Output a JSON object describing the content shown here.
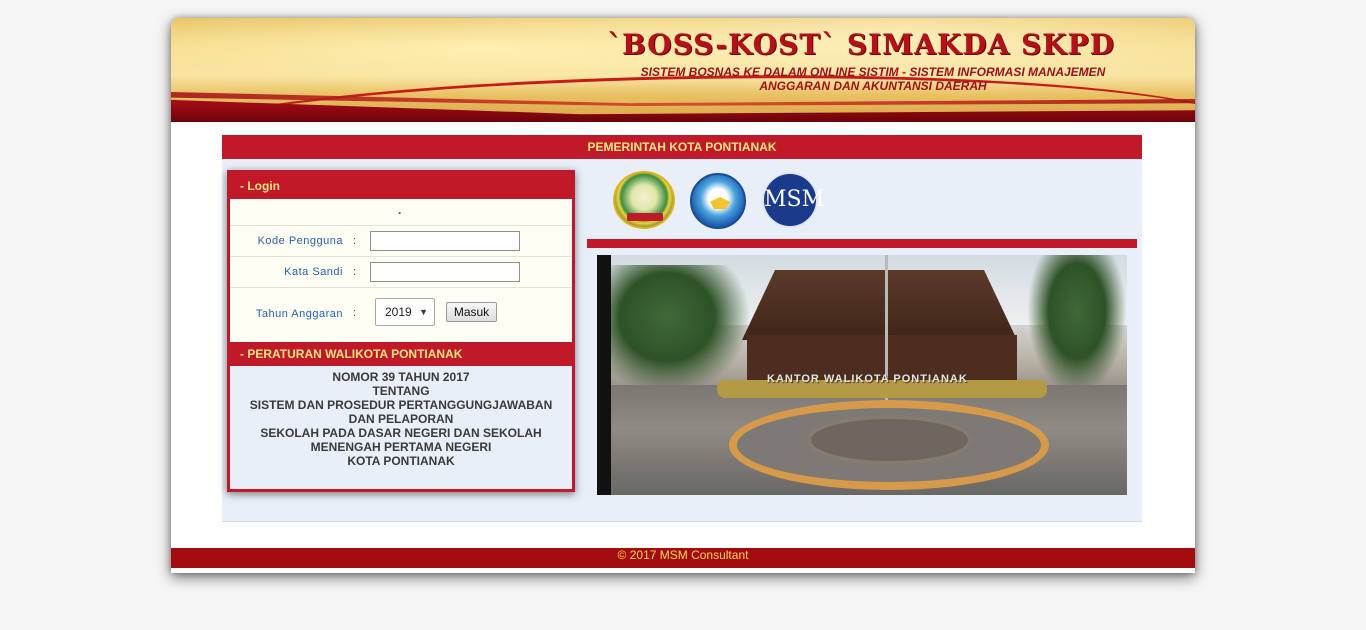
{
  "header": {
    "title": "`BOSS-KOST`  SIMAKDA SKPD",
    "subtitle_line1": "SISTEM BOSNAS KE DALAM ONLINE SISTIM - SISTEM INFORMASI MANAJEMEN",
    "subtitle_line2": "ANGGARAN DAN AKUNTANSI DAERAH"
  },
  "government_bar": "PEMERINTAH KOTA PONTIANAK",
  "login": {
    "heading": "- Login",
    "message": ".",
    "username_label": "Kode Pengguna",
    "username_value": "",
    "password_label": "Kata Sandi",
    "password_value": "",
    "year_label": "Tahun Anggaran",
    "year_selected": "2019",
    "submit_label": "Masuk",
    "colon": ":"
  },
  "regulation": {
    "heading": "- PERATURAN WALIKOTA PONTIANAK",
    "lines": [
      "NOMOR 39 TAHUN 2017",
      "TENTANG",
      "SISTEM DAN PROSEDUR PERTANGGUNGJAWABAN",
      "DAN PELAPORAN",
      "SEKOLAH PADA DASAR NEGERI DAN SEKOLAH",
      "MENENGAH PERTAMA NEGERI",
      "KOTA PONTIANAK"
    ]
  },
  "logos": [
    {
      "name": "kota-pontianak-logo",
      "text": "KOTA PONTIANAK"
    },
    {
      "name": "tut-wuri-handayani-logo"
    },
    {
      "name": "msm-logo",
      "text": "MSM"
    }
  ],
  "photo_caption": "KANTOR WALIKOTA PONTIANAK",
  "footer": "© 2017 MSM Consultant",
  "colors": {
    "accent_red": "#c0192a",
    "accent_yellow": "#ffe680",
    "footer_red": "#a30d10"
  }
}
